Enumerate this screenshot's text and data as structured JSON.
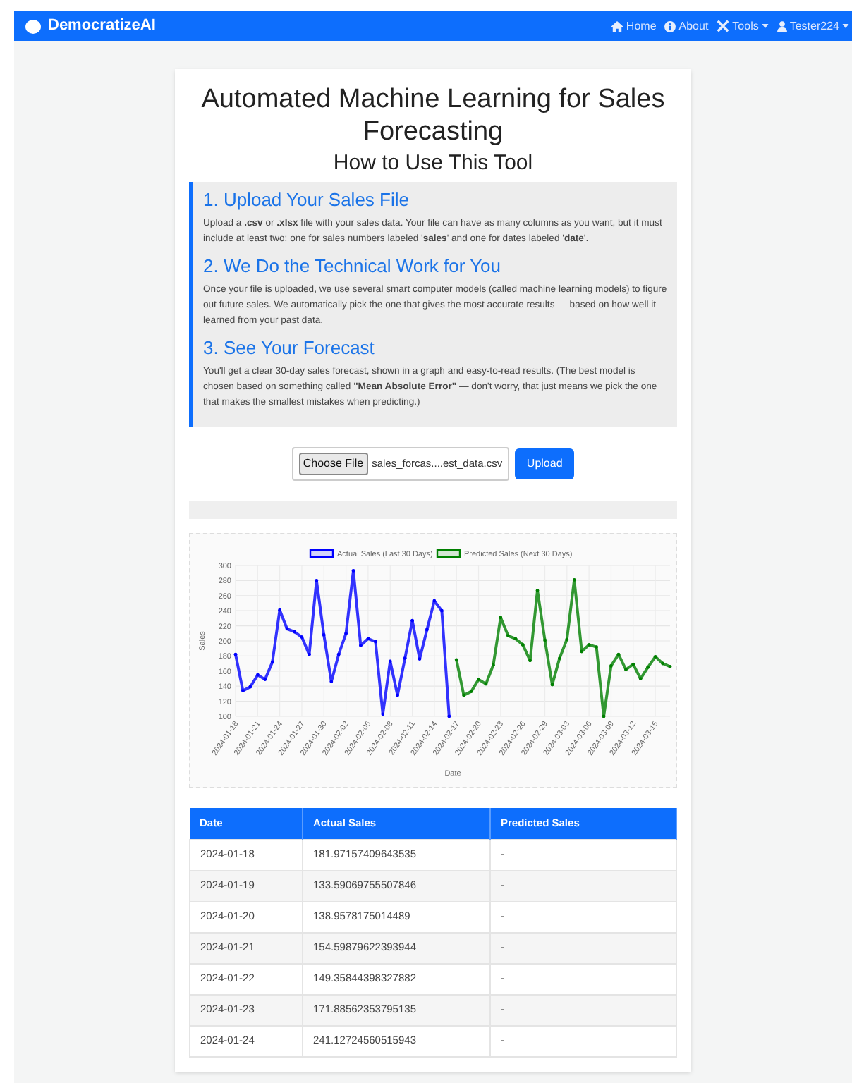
{
  "navbar": {
    "brand": "DemocratizeAI",
    "links": [
      {
        "label": "Home",
        "kind": "home"
      },
      {
        "label": "About",
        "kind": "about"
      },
      {
        "label": "Tools",
        "kind": "tools"
      },
      {
        "label": "Tester224",
        "kind": "user"
      }
    ]
  },
  "title": "Automated Machine Learning for Sales Forecasting",
  "subtitle": "How to Use This Tool",
  "steps": [
    {
      "heading": "1. Upload Your Sales File",
      "text": "Upload a **.csv** or **.xlsx** file with your sales data. Your file can have as many columns as you want, but it must include at least two: one for sales numbers labeled '**sales**' and one for dates labeled '**date**'."
    },
    {
      "heading": "2. We Do the Technical Work for You",
      "text": "Once your file is uploaded, we use several smart computer models (called machine learning models) to figure out future sales. We automatically pick the one that gives the most accurate results — based on how well it learned from your past data."
    },
    {
      "heading": "3. See Your Forecast",
      "text": "You'll get a clear 30-day sales forecast, shown in a graph and easy-to-read results. (The best model is chosen based on something called **\"Mean Absolute Error\"** — don't worry, that just means we pick the one that makes the smallest mistakes when predicting.)"
    }
  ],
  "upload": {
    "choose_label": "Choose File",
    "file_name": "sales_forcas....est_data.csv",
    "button": "Upload"
  },
  "chart_data": {
    "type": "line",
    "xlabel": "Date",
    "ylabel": "Sales",
    "grid": true,
    "legend": "top",
    "ylim": [
      100,
      300
    ],
    "yticks": [
      100,
      120,
      140,
      160,
      180,
      200,
      220,
      240,
      260,
      280,
      300
    ],
    "categories": [
      "2024-01-18",
      null,
      null,
      "2024-01-21",
      null,
      null,
      "2024-01-24",
      null,
      null,
      "2024-01-27",
      null,
      null,
      "2024-01-30",
      null,
      null,
      "2024-02-02",
      null,
      null,
      "2024-02-05",
      null,
      null,
      "2024-02-08",
      null,
      null,
      "2024-02-11",
      null,
      null,
      "2024-02-14",
      null,
      null,
      "2024-02-17",
      null,
      null,
      "2024-02-20",
      null,
      null,
      "2024-02-23",
      null,
      null,
      "2024-02-26",
      null,
      null,
      "2024-02-29",
      null,
      null,
      "2024-03-03",
      null,
      null,
      "2024-03-06",
      null,
      null,
      "2024-03-09",
      null,
      null,
      "2024-03-12",
      null,
      null,
      "2024-03-15",
      null,
      null
    ],
    "series": [
      {
        "name": "Actual Sales (Last 30 Days)",
        "color": "#0000ff",
        "values": [
          182,
          134,
          139,
          155,
          149,
          172,
          241,
          216,
          212,
          205,
          182,
          280,
          208,
          146,
          182,
          210,
          293,
          194,
          203,
          199,
          103,
          173,
          128,
          177,
          227,
          176,
          215,
          253,
          240,
          100,
          null,
          null,
          null,
          null,
          null,
          null,
          null,
          null,
          null,
          null,
          null,
          null,
          null,
          null,
          null,
          null,
          null,
          null,
          null,
          null,
          null,
          null,
          null,
          null,
          null,
          null,
          null,
          null,
          null,
          null
        ]
      },
      {
        "name": "Predicted Sales (Next 30 Days)",
        "color": "#008000",
        "values": [
          null,
          null,
          null,
          null,
          null,
          null,
          null,
          null,
          null,
          null,
          null,
          null,
          null,
          null,
          null,
          null,
          null,
          null,
          null,
          null,
          null,
          null,
          null,
          null,
          null,
          null,
          null,
          null,
          null,
          null,
          175,
          128,
          133,
          149,
          143,
          168,
          231,
          207,
          203,
          195,
          174,
          267,
          201,
          142,
          177,
          202,
          281,
          186,
          195,
          192,
          100,
          167,
          182,
          162,
          169,
          150,
          165,
          179,
          170,
          166
        ]
      }
    ]
  },
  "table": {
    "columns": [
      "Date",
      "Actual Sales",
      "Predicted Sales"
    ],
    "rows": [
      [
        "2024-01-18",
        "181.97157409643535",
        "-"
      ],
      [
        "2024-01-19",
        "133.59069755507846",
        "-"
      ],
      [
        "2024-01-20",
        "138.9578175014489",
        "-"
      ],
      [
        "2024-01-21",
        "154.59879622393944",
        "-"
      ],
      [
        "2024-01-22",
        "149.35844398327882",
        "-"
      ],
      [
        "2024-01-23",
        "171.88562353795135",
        "-"
      ],
      [
        "2024-01-24",
        "241.12724560515943",
        "-"
      ]
    ]
  }
}
